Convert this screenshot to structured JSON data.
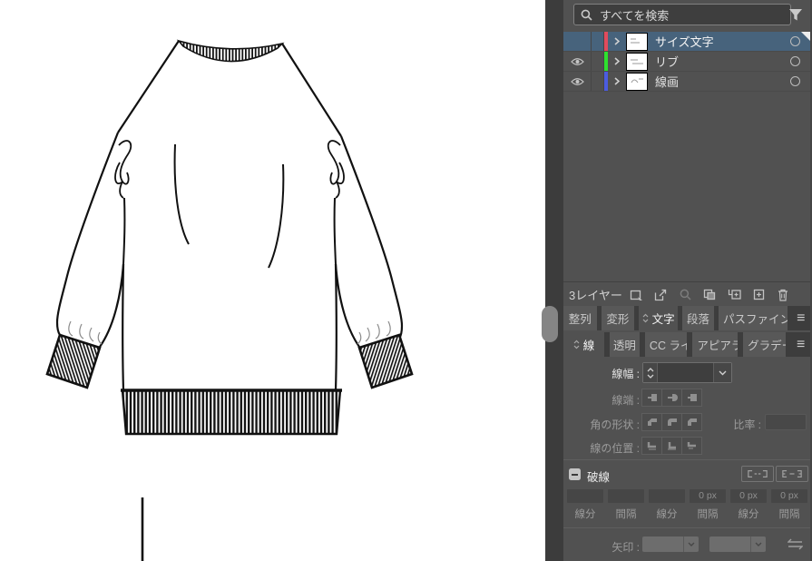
{
  "search": {
    "placeholder": "すべてを検索"
  },
  "layers_panel": {
    "rows": [
      {
        "label": "サイズ文字",
        "color": "#e14b5d",
        "visible": false,
        "selected": true
      },
      {
        "label": "リブ",
        "color": "#2ee12e",
        "visible": true,
        "selected": false
      },
      {
        "label": "線画",
        "color": "#4b5ce1",
        "visible": true,
        "selected": false
      }
    ],
    "status": "3レイヤー",
    "toolbar_icons": [
      "collect-for-export",
      "share",
      "locate-object",
      "make-clipping-mask",
      "new-sublayer",
      "new-layer",
      "delete"
    ]
  },
  "tabs_row1": [
    {
      "label": "整列",
      "active": false
    },
    {
      "label": "変形",
      "active": false
    },
    {
      "label": "文字",
      "active": true
    },
    {
      "label": "段落",
      "active": false
    },
    {
      "label": "パスファインダー",
      "active": false
    }
  ],
  "tabs_row2": [
    {
      "label": "線",
      "active": true
    },
    {
      "label": "透明",
      "active": false
    },
    {
      "label": "CC ライブラリ",
      "active": false
    },
    {
      "label": "アピアランス",
      "active": false
    },
    {
      "label": "グラデーション",
      "active": false
    }
  ],
  "stroke_panel": {
    "width_label": "線幅 :",
    "width_value": "",
    "cap_label": "線端 :",
    "corner_label": "角の形状 :",
    "limit_label": "比率 :",
    "limit_value": "",
    "align_label": "線の位置 :",
    "dash_label": "破線",
    "dash_checked": true,
    "dash_fields": [
      {
        "value": "",
        "label": "線分"
      },
      {
        "value": "",
        "label": "間隔"
      },
      {
        "value": "",
        "label": "線分"
      },
      {
        "value": "0 px",
        "label": "間隔"
      },
      {
        "value": "0 px",
        "label": "線分"
      },
      {
        "value": "0 px",
        "label": "間隔"
      }
    ],
    "arrow_label": "矢印 :",
    "arrow_value_start": "",
    "arrow_value_end": ""
  },
  "icons": {
    "panel_menu": "≡"
  },
  "colors": {
    "panel_bg": "#515151",
    "selection_blue": "#47637c",
    "tabbar_bg": "#3d3d3d",
    "field_bg": "#3e3e3e",
    "layer_red": "#e14b5d",
    "layer_green": "#2ee12e",
    "layer_blue": "#4b5ce1"
  }
}
